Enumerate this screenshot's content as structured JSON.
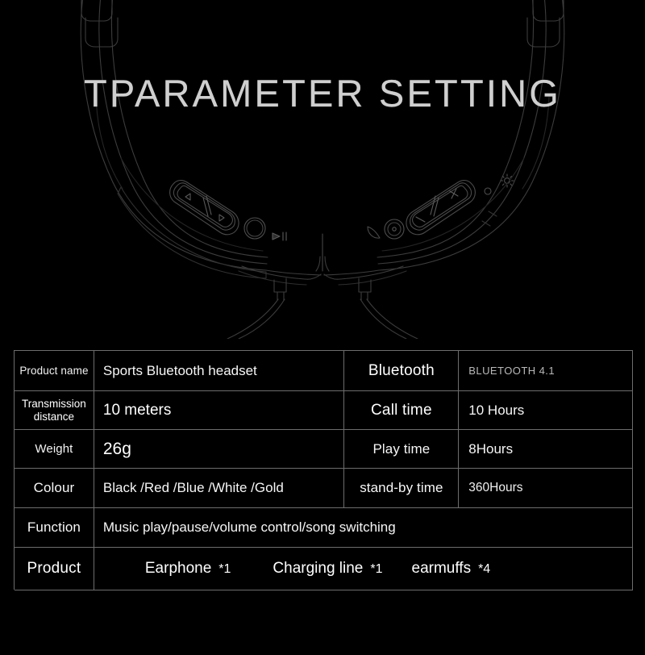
{
  "hero": {
    "title": "TPARAMETER SETTING",
    "illustration_name": "bluetooth-neckband-headset-line-art",
    "line_color": "#3a3a3a",
    "background_color": "#000000",
    "controls": {
      "left_rocker_prev": "◁",
      "left_rocker_next": "▷",
      "play_pause_glyph": "▶||",
      "right_rocker_minus": "−",
      "right_rocker_plus": "+",
      "led_indicator": "led-icon"
    }
  },
  "table": {
    "border_color": "#6d6d6d",
    "rows": [
      {
        "label": "Product name",
        "value": "Sports Bluetooth headset",
        "label2": "Bluetooth",
        "value2": "BLUETOOTH 4.1"
      },
      {
        "label_line1": "Transmission",
        "label_line2": "distance",
        "value": "10 meters",
        "label2": "Call time",
        "value2": "10 Hours"
      },
      {
        "label": "Weight",
        "value": "26g",
        "label2": "Play time",
        "value2": "8Hours"
      },
      {
        "label": "Colour",
        "value": "Black /Red /Blue /White /Gold",
        "label2": "stand-by time",
        "value2": "360Hours"
      },
      {
        "label": "Function",
        "value": "Music play/pause/volume control/song switching"
      },
      {
        "label": "Product",
        "items": [
          {
            "name": "Earphone",
            "qty": "*1"
          },
          {
            "name": "Charging line",
            "qty": "*1"
          },
          {
            "name": "earmuffs",
            "qty": "*4"
          }
        ]
      }
    ]
  }
}
